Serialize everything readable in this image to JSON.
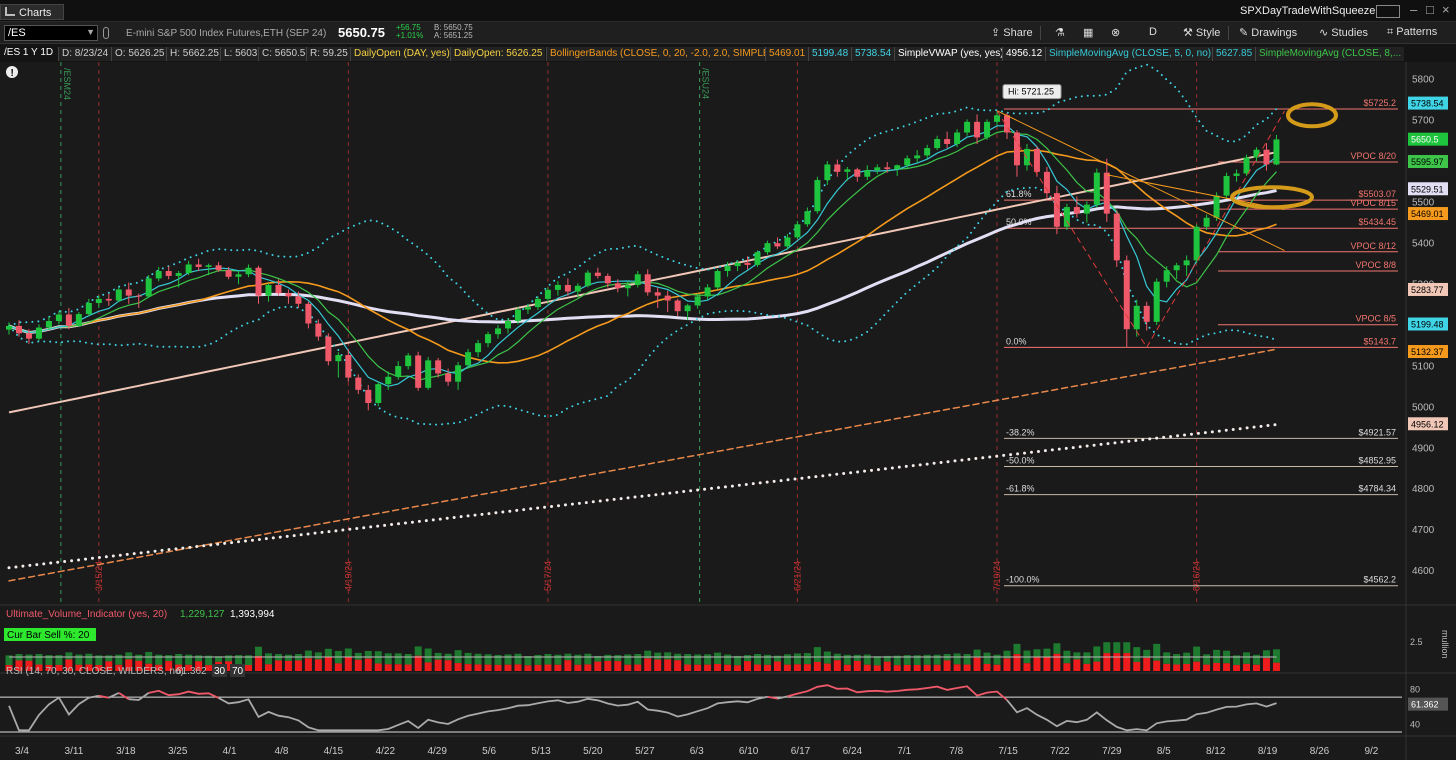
{
  "window": {
    "title": "Charts",
    "account": "SPXDayTradeWithSqueeze"
  },
  "toolbar": {
    "symbol": "/ES",
    "description": "E-mini S&P 500 Index Futures,ETH (SEP 24)",
    "last": "5650.75",
    "net_change": "+56.75",
    "pct_change": "+1.01%",
    "bid": "B: 5650.75",
    "ask": "A: 5651.25",
    "share": "Share",
    "aggregation": "D",
    "style": "Style",
    "drawings": "Drawings",
    "studies": "Studies",
    "patterns": "Patterns"
  },
  "studybar": {
    "chart_id": "/ES 1 Y 1D",
    "date": "D: 8/23/24",
    "open": "O: 5626.25",
    "high": "H: 5662.25",
    "low": "L: 5603",
    "close": "C: 5650.5",
    "range": "R: 59.25",
    "daily_open_label": "DailyOpen (DAY, yes)",
    "daily_open_value": "DailyOpen: 5626.25",
    "bb_label": "BollingerBands (CLOSE, 0, 20, -2.0, 2.0, SIMPLE)",
    "bb_mid": "5469.01",
    "bb_low": "5199.48",
    "bb_up": "5738.54",
    "vwap_label": "SimpleVWAP (yes, yes)",
    "vwap_value": "4956.12",
    "sma1_label": "SimpleMovingAvg (CLOSE, 5, 0, no)",
    "sma1_value": "5627.85",
    "sma2_label": "SimpleMovingAvg (CLOSE, 8,..."
  },
  "colors": {
    "up": "#1fc43e",
    "down": "#f0596a",
    "bb": "#3fd4e6",
    "sma5": "#36c9d6",
    "sma8": "#3dc449",
    "sma20": "#f59a1c",
    "sma50": "#e2dff5",
    "sma200": "#f1c7b7",
    "level": "#f2756f",
    "fib": "#dddddd"
  },
  "chart_data": {
    "type": "candlestick",
    "symbol": "/ES",
    "ylim": [
      4520,
      5840
    ],
    "y_ticks": [
      4600,
      4700,
      4800,
      4900,
      5000,
      5100,
      5200,
      5300,
      5400,
      5500,
      5600,
      5700,
      5800
    ],
    "x_ticks": [
      "3/4",
      "3/11",
      "3/18",
      "3/25",
      "4/1",
      "4/8",
      "4/15",
      "4/22",
      "4/29",
      "5/6",
      "5/13",
      "5/20",
      "5/27",
      "6/3",
      "6/10",
      "6/17",
      "6/24",
      "7/1",
      "7/8",
      "7/15",
      "7/22",
      "7/29",
      "8/5",
      "8/12",
      "8/19",
      "8/26",
      "9/2"
    ],
    "candles": [
      [
        5187,
        5205,
        5175,
        5196
      ],
      [
        5196,
        5210,
        5170,
        5178
      ],
      [
        5178,
        5188,
        5152,
        5165
      ],
      [
        5165,
        5200,
        5160,
        5192
      ],
      [
        5192,
        5218,
        5186,
        5208
      ],
      [
        5208,
        5232,
        5200,
        5224
      ],
      [
        5224,
        5240,
        5188,
        5196
      ],
      [
        5196,
        5230,
        5194,
        5225
      ],
      [
        5225,
        5262,
        5220,
        5252
      ],
      [
        5252,
        5270,
        5240,
        5262
      ],
      [
        5262,
        5275,
        5245,
        5258
      ],
      [
        5258,
        5290,
        5255,
        5285
      ],
      [
        5285,
        5302,
        5250,
        5270
      ],
      [
        5270,
        5275,
        5240,
        5268
      ],
      [
        5268,
        5320,
        5265,
        5312
      ],
      [
        5312,
        5340,
        5305,
        5330
      ],
      [
        5330,
        5342,
        5310,
        5318
      ],
      [
        5318,
        5330,
        5290,
        5325
      ],
      [
        5325,
        5355,
        5320,
        5346
      ],
      [
        5346,
        5360,
        5330,
        5340
      ],
      [
        5340,
        5348,
        5320,
        5344
      ],
      [
        5344,
        5352,
        5328,
        5332
      ],
      [
        5332,
        5340,
        5310,
        5316
      ],
      [
        5316,
        5330,
        5298,
        5322
      ],
      [
        5322,
        5346,
        5315,
        5338
      ],
      [
        5338,
        5343,
        5250,
        5270
      ],
      [
        5270,
        5300,
        5255,
        5296
      ],
      [
        5296,
        5310,
        5270,
        5276
      ],
      [
        5276,
        5285,
        5250,
        5268
      ],
      [
        5268,
        5280,
        5240,
        5250
      ],
      [
        5250,
        5255,
        5190,
        5202
      ],
      [
        5202,
        5212,
        5160,
        5170
      ],
      [
        5170,
        5178,
        5100,
        5110
      ],
      [
        5110,
        5132,
        5070,
        5125
      ],
      [
        5125,
        5140,
        5060,
        5070
      ],
      [
        5070,
        5078,
        5030,
        5040
      ],
      [
        5040,
        5052,
        4990,
        5008
      ],
      [
        5008,
        5060,
        5000,
        5054
      ],
      [
        5054,
        5085,
        5040,
        5072
      ],
      [
        5072,
        5110,
        5065,
        5098
      ],
      [
        5098,
        5130,
        5090,
        5124
      ],
      [
        5124,
        5133,
        5038,
        5045
      ],
      [
        5045,
        5120,
        5040,
        5112
      ],
      [
        5112,
        5118,
        5070,
        5080
      ],
      [
        5080,
        5092,
        5050,
        5060
      ],
      [
        5060,
        5108,
        5040,
        5100
      ],
      [
        5100,
        5140,
        5092,
        5132
      ],
      [
        5132,
        5162,
        5120,
        5154
      ],
      [
        5154,
        5182,
        5144,
        5176
      ],
      [
        5176,
        5198,
        5165,
        5190
      ],
      [
        5190,
        5215,
        5178,
        5208
      ],
      [
        5208,
        5242,
        5200,
        5236
      ],
      [
        5236,
        5250,
        5225,
        5242
      ],
      [
        5242,
        5268,
        5235,
        5262
      ],
      [
        5262,
        5290,
        5250,
        5284
      ],
      [
        5284,
        5305,
        5270,
        5296
      ],
      [
        5296,
        5312,
        5270,
        5280
      ],
      [
        5280,
        5300,
        5265,
        5294
      ],
      [
        5294,
        5332,
        5290,
        5326
      ],
      [
        5326,
        5338,
        5312,
        5318
      ],
      [
        5318,
        5324,
        5290,
        5300
      ],
      [
        5300,
        5310,
        5278,
        5288
      ],
      [
        5288,
        5305,
        5268,
        5296
      ],
      [
        5296,
        5330,
        5290,
        5322
      ],
      [
        5322,
        5334,
        5270,
        5278
      ],
      [
        5278,
        5290,
        5240,
        5270
      ],
      [
        5270,
        5282,
        5230,
        5258
      ],
      [
        5258,
        5262,
        5220,
        5232
      ],
      [
        5232,
        5250,
        5210,
        5246
      ],
      [
        5246,
        5275,
        5238,
        5268
      ],
      [
        5268,
        5298,
        5260,
        5290
      ],
      [
        5290,
        5335,
        5285,
        5330
      ],
      [
        5330,
        5352,
        5316,
        5342
      ],
      [
        5342,
        5356,
        5330,
        5350
      ],
      [
        5350,
        5366,
        5334,
        5345
      ],
      [
        5345,
        5380,
        5340,
        5376
      ],
      [
        5376,
        5404,
        5370,
        5398
      ],
      [
        5398,
        5412,
        5384,
        5390
      ],
      [
        5390,
        5420,
        5382,
        5412
      ],
      [
        5412,
        5452,
        5408,
        5444
      ],
      [
        5444,
        5485,
        5438,
        5476
      ],
      [
        5476,
        5560,
        5470,
        5552
      ],
      [
        5552,
        5598,
        5540,
        5590
      ],
      [
        5590,
        5602,
        5560,
        5572
      ],
      [
        5572,
        5584,
        5550,
        5578
      ],
      [
        5578,
        5582,
        5548,
        5560
      ],
      [
        5560,
        5588,
        5552,
        5576
      ],
      [
        5576,
        5590,
        5566,
        5583
      ],
      [
        5583,
        5596,
        5570,
        5579
      ],
      [
        5579,
        5590,
        5562,
        5588
      ],
      [
        5588,
        5612,
        5580,
        5605
      ],
      [
        5605,
        5625,
        5594,
        5612
      ],
      [
        5612,
        5638,
        5604,
        5630
      ],
      [
        5630,
        5660,
        5625,
        5652
      ],
      [
        5652,
        5670,
        5630,
        5640
      ],
      [
        5640,
        5676,
        5632,
        5668
      ],
      [
        5668,
        5700,
        5660,
        5694
      ],
      [
        5694,
        5712,
        5640,
        5656
      ],
      [
        5656,
        5700,
        5650,
        5694
      ],
      [
        5694,
        5721,
        5686,
        5710
      ],
      [
        5710,
        5716,
        5652,
        5668
      ],
      [
        5668,
        5674,
        5560,
        5588
      ],
      [
        5588,
        5640,
        5575,
        5628
      ],
      [
        5628,
        5634,
        5560,
        5572
      ],
      [
        5572,
        5584,
        5505,
        5520
      ],
      [
        5520,
        5538,
        5420,
        5438
      ],
      [
        5438,
        5494,
        5430,
        5486
      ],
      [
        5486,
        5512,
        5460,
        5470
      ],
      [
        5470,
        5500,
        5448,
        5492
      ],
      [
        5492,
        5580,
        5485,
        5570
      ],
      [
        5570,
        5604,
        5450,
        5470
      ],
      [
        5470,
        5478,
        5340,
        5356
      ],
      [
        5356,
        5368,
        5144,
        5188
      ],
      [
        5188,
        5260,
        5170,
        5245
      ],
      [
        5245,
        5255,
        5185,
        5206
      ],
      [
        5206,
        5312,
        5198,
        5304
      ],
      [
        5304,
        5342,
        5290,
        5332
      ],
      [
        5332,
        5350,
        5310,
        5344
      ],
      [
        5344,
        5368,
        5318,
        5356
      ],
      [
        5356,
        5444,
        5350,
        5438
      ],
      [
        5438,
        5468,
        5430,
        5460
      ],
      [
        5460,
        5522,
        5452,
        5514
      ],
      [
        5514,
        5570,
        5506,
        5562
      ],
      [
        5562,
        5578,
        5548,
        5568
      ],
      [
        5568,
        5614,
        5562,
        5607
      ],
      [
        5607,
        5632,
        5598,
        5626
      ],
      [
        5626,
        5642,
        5575,
        5590
      ],
      [
        5590,
        5662,
        5588,
        5651
      ]
    ],
    "horizontal_levels": [
      {
        "price": 5725.2,
        "label": "$5725.2"
      },
      {
        "price": 5596,
        "label": "VPOC 8/20"
      },
      {
        "price": 5503.07,
        "label": "$5503.07"
      },
      {
        "price": 5481,
        "label": "VPOC 8/15"
      },
      {
        "price": 5434.45,
        "label": "$5434.45"
      },
      {
        "price": 5377,
        "label": "VPOC 8/12"
      },
      {
        "price": 5330,
        "label": "VPOC 8/8"
      },
      {
        "price": 5199,
        "label": "VPOC 8/5"
      },
      {
        "price": 5143.7,
        "label": "$5143.7"
      },
      {
        "price": 4921.57,
        "label": "$4921.57"
      },
      {
        "price": 4852.95,
        "label": "$4852.95"
      },
      {
        "price": 4784.34,
        "label": "$4784.34"
      },
      {
        "price": 4562.2,
        "label": "$4562.2"
      }
    ],
    "fib_labels": [
      {
        "price": 5503.07,
        "label": "61.8%"
      },
      {
        "price": 5434.45,
        "label": "50.0%"
      },
      {
        "price": 5143.7,
        "label": "0.0%"
      },
      {
        "price": 4921.57,
        "label": "-38.2%"
      },
      {
        "price": 4852.95,
        "label": "-50.0%"
      },
      {
        "price": 4784.34,
        "label": "-61.8%"
      },
      {
        "price": 4562.2,
        "label": "-100.0%"
      }
    ],
    "hi_label": "Hi: 5721.25",
    "expiry_labels": [
      "/ESM24",
      "/ESU24"
    ],
    "vertical_date_labels": [
      "3/15/24",
      "4/19/24",
      "5/17/24",
      "6/21/24",
      "7/19/24",
      "8/16/24"
    ],
    "price_tags": [
      {
        "price": 5738.54,
        "text": "5738.54",
        "bg": "#3fd4e6",
        "fg": "#000"
      },
      {
        "price": 5650.5,
        "text": "5650.5",
        "bg": "#1fc43e",
        "fg": "#fff"
      },
      {
        "price": 5595.97,
        "text": "5595.97",
        "bg": "#3dc449",
        "fg": "#000"
      },
      {
        "price": 5529.51,
        "text": "5529.51",
        "bg": "#e2dff5",
        "fg": "#000"
      },
      {
        "price": 5469.01,
        "text": "5469.01",
        "bg": "#f59a1c",
        "fg": "#000"
      },
      {
        "price": 5283.77,
        "text": "5283.77",
        "bg": "#f1c7b7",
        "fg": "#000"
      },
      {
        "price": 5199.48,
        "text": "5199.48",
        "bg": "#3fd4e6",
        "fg": "#000"
      },
      {
        "price": 5132.37,
        "text": "5132.37",
        "bg": "#f59a1c",
        "fg": "#000"
      },
      {
        "price": 4956.12,
        "text": "4956.12",
        "bg": "#f1c7b7",
        "fg": "#000"
      }
    ],
    "volume_panel": {
      "label": "Ultimate_Volume_Indicator (yes, 20)",
      "value1": "1,229,127",
      "value2": "1,393,994",
      "cur_bar_label": "Cur Bar Sell %: 20",
      "axis_tick": "2.5",
      "axis_unit": "mullion"
    },
    "rsi_panel": {
      "label": "RSI (14, 70, 30, CLOSE, WILDERS, no)",
      "value": "61.362",
      "ob": "30",
      "os": "70",
      "ticks": [
        "80",
        "40"
      ],
      "value_tag": "61.362"
    }
  }
}
